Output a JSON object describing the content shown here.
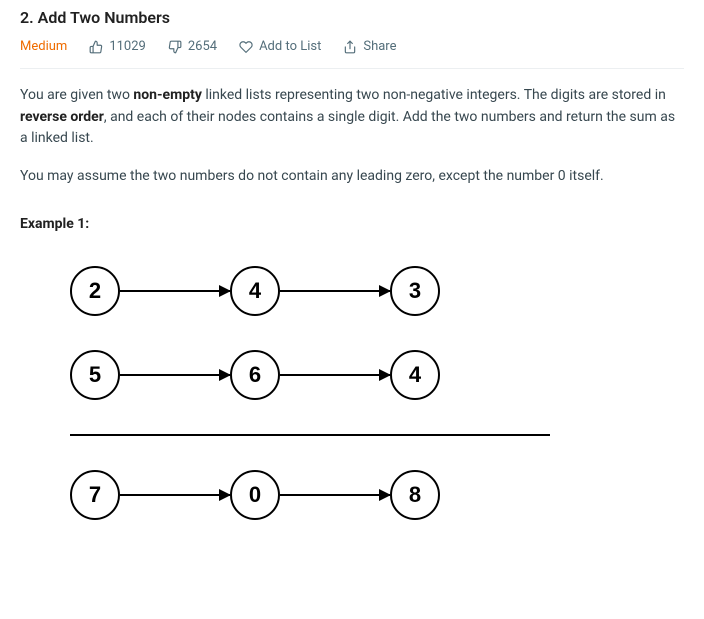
{
  "title": "2. Add Two Numbers",
  "meta": {
    "difficulty": "Medium",
    "likes": "11029",
    "dislikes": "2654",
    "add_to_list": "Add to List",
    "share": "Share"
  },
  "desc": {
    "p1a": "You are given two ",
    "p1_bold1": "non-empty",
    "p1b": " linked lists representing two non-negative integers. The digits are stored in ",
    "p1_bold2": "reverse order",
    "p1c": ", and each of their nodes contains a single digit. Add the two numbers and return the sum as a linked list.",
    "p2": "You may assume the two numbers do not contain any leading zero, except the number 0 itself."
  },
  "example_label": "Example 1:",
  "lists": {
    "row1": [
      "2",
      "4",
      "3"
    ],
    "row2": [
      "5",
      "6",
      "4"
    ],
    "row3": [
      "7",
      "0",
      "8"
    ]
  }
}
